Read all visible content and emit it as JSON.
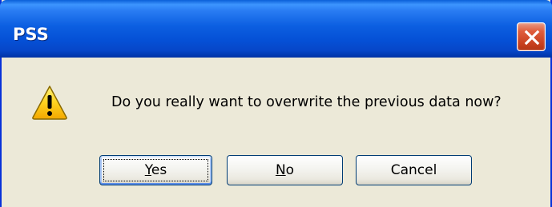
{
  "window": {
    "title": "PSS",
    "close_icon": "close-icon"
  },
  "dialog": {
    "icon": "warning-icon",
    "message": "Do you really want to overwrite the previous data now?"
  },
  "buttons": {
    "yes": {
      "prefix": "",
      "mnemonic": "Y",
      "rest": "es"
    },
    "no": {
      "prefix": "",
      "mnemonic": "N",
      "rest": "o"
    },
    "cancel": {
      "label": "Cancel"
    }
  },
  "colors": {
    "titlebar": "#0550d6",
    "dialog_bg": "#ece9d8",
    "close_button": "#d6502c",
    "warning_fill": "#ffd21f"
  }
}
